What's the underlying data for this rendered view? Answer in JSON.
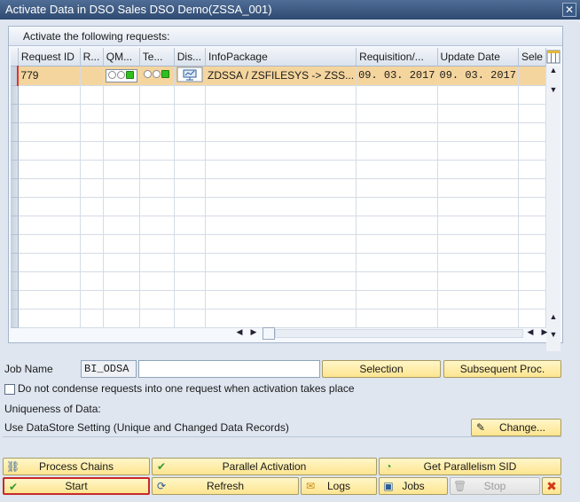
{
  "window": {
    "title": "Activate Data in DSO Sales DSO Demo(ZSSA_001)",
    "close": "✕"
  },
  "panel": {
    "title": "Activate the following requests:",
    "columns": [
      "Request ID",
      "R...",
      "QM...",
      "Te...",
      "Dis...",
      "InfoPackage",
      "Requisition/...",
      "Update Date",
      "Sele"
    ],
    "row": {
      "request_id": "779",
      "infopackage": "ZDSSA / ZSFILESYS -> ZSS...",
      "requisition": "09. 03. 2017",
      "update_date": "09. 03. 2017"
    }
  },
  "job": {
    "label": "Job Name",
    "prefix": "BI_ODSA",
    "name_value": "",
    "selection_label": "Selection",
    "subsequent_label": "Subsequent Proc."
  },
  "condense": {
    "label": "Do not condense requests into one request when activation takes place",
    "checked": false
  },
  "uniqueness": {
    "label": "Uniqueness of Data:",
    "setting": "Use DataStore Setting (Unique and Changed Data Records)",
    "change_label": "Change..."
  },
  "actions": {
    "process_chains": "Process Chains",
    "parallel_activation": "Parallel Activation",
    "get_parallelism": "Get Parallelism SID",
    "start": "Start",
    "refresh": "Refresh",
    "logs": "Logs",
    "jobs": "Jobs",
    "stop": "Stop"
  },
  "colors": {
    "title_bar": "#3a5a85",
    "selected_row": "#f5d59e",
    "button": "#fde58f",
    "focus_border": "#c72a2a"
  }
}
